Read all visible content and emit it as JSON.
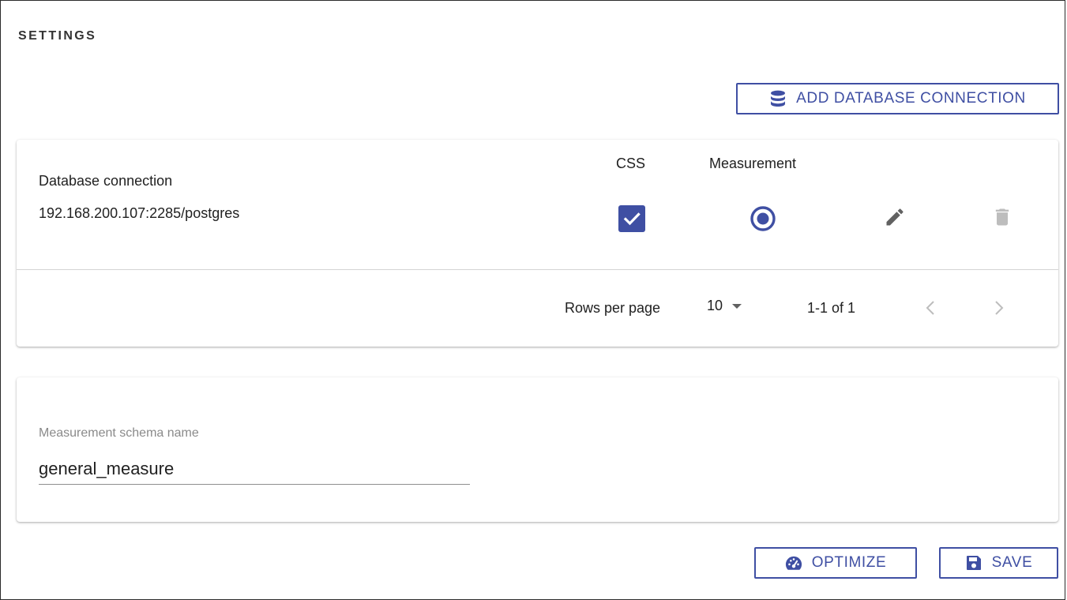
{
  "page": {
    "title": "SETTINGS"
  },
  "toolbar": {
    "add_connection_label": "ADD DATABASE CONNECTION",
    "add_connection_icon": "database-icon"
  },
  "table": {
    "headers": {
      "database_connection": "Database connection",
      "css": "CSS",
      "measurement": "Measurement"
    },
    "rows": [
      {
        "database_connection": "192.168.200.107:2285/postgres",
        "css_checked": true,
        "measurement_selected": true,
        "edit_icon": "pencil-icon",
        "delete_icon": "trash-icon"
      }
    ],
    "pagination": {
      "rows_per_page_label": "Rows per page",
      "rows_per_page_value": "10",
      "range_text": "1-1 of 1"
    }
  },
  "schema": {
    "label": "Measurement schema name",
    "value": "general_measure"
  },
  "actions": {
    "optimize_label": "OPTIMIZE",
    "optimize_icon": "speedometer-icon",
    "save_label": "SAVE",
    "save_icon": "floppy-disk-icon"
  },
  "colors": {
    "primary": "#3f4fa3",
    "icon_gray": "#757575",
    "disabled_gray": "#bdbdbd"
  }
}
